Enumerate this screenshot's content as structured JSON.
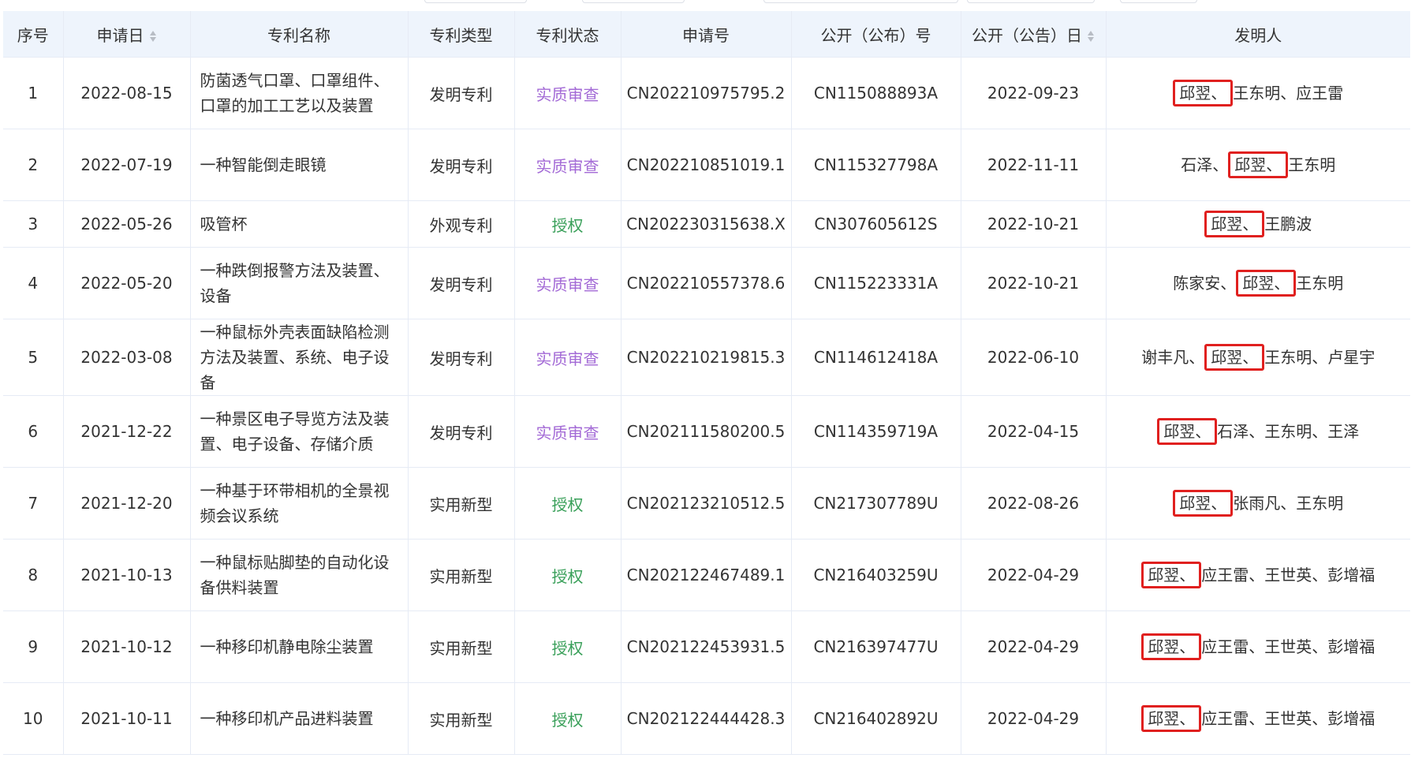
{
  "table": {
    "headers": [
      "序号",
      "申请日",
      "专利名称",
      "专利类型",
      "专利状态",
      "申请号",
      "公开（公布）号",
      "公开（公告）日",
      "发明人"
    ],
    "rows": [
      {
        "no": "1",
        "date": "2022-08-15",
        "name": "防菌透气口罩、口罩组件、口罩的加工工艺以及装置",
        "type": "发明专利",
        "status": "实质审查",
        "app_no": "CN202210975795.2",
        "pub_no": "CN115088893A",
        "pub_date": "2022-09-23",
        "inv_before": "",
        "inv_hl": "邱翌、",
        "inv_after": "王东明、应王雷"
      },
      {
        "no": "2",
        "date": "2022-07-19",
        "name": "一种智能倒走眼镜",
        "type": "发明专利",
        "status": "实质审查",
        "app_no": "CN202210851019.1",
        "pub_no": "CN115327798A",
        "pub_date": "2022-11-11",
        "inv_before": "石泽、",
        "inv_hl": "邱翌、",
        "inv_after": "王东明"
      },
      {
        "no": "3",
        "date": "2022-05-26",
        "name": "吸管杯",
        "type": "外观专利",
        "status": "授权",
        "app_no": "CN202230315638.X",
        "pub_no": "CN307605612S",
        "pub_date": "2022-10-21",
        "inv_before": "",
        "inv_hl": "邱翌、",
        "inv_after": "王鹏波"
      },
      {
        "no": "4",
        "date": "2022-05-20",
        "name": "一种跌倒报警方法及装置、设备",
        "type": "发明专利",
        "status": "实质审查",
        "app_no": "CN202210557378.6",
        "pub_no": "CN115223331A",
        "pub_date": "2022-10-21",
        "inv_before": "陈家安、",
        "inv_hl": "邱翌、",
        "inv_after": "王东明"
      },
      {
        "no": "5",
        "date": "2022-03-08",
        "name": "一种鼠标外壳表面缺陷检测方法及装置、系统、电子设备",
        "type": "发明专利",
        "status": "实质审查",
        "app_no": "CN202210219815.3",
        "pub_no": "CN114612418A",
        "pub_date": "2022-06-10",
        "inv_before": "谢丰凡、",
        "inv_hl": "邱翌、",
        "inv_after": "王东明、卢星宇"
      },
      {
        "no": "6",
        "date": "2021-12-22",
        "name": "一种景区电子导览方法及装置、电子设备、存储介质",
        "type": "发明专利",
        "status": "实质审查",
        "app_no": "CN202111580200.5",
        "pub_no": "CN114359719A",
        "pub_date": "2022-04-15",
        "inv_before": "",
        "inv_hl": "邱翌、",
        "inv_after": "石泽、王东明、王泽"
      },
      {
        "no": "7",
        "date": "2021-12-20",
        "name": "一种基于环带相机的全景视频会议系统",
        "type": "实用新型",
        "status": "授权",
        "app_no": "CN202123210512.5",
        "pub_no": "CN217307789U",
        "pub_date": "2022-08-26",
        "inv_before": "",
        "inv_hl": "邱翌、",
        "inv_after": "张雨凡、王东明"
      },
      {
        "no": "8",
        "date": "2021-10-13",
        "name": "一种鼠标贴脚垫的自动化设备供料装置",
        "type": "实用新型",
        "status": "授权",
        "app_no": "CN202122467489.1",
        "pub_no": "CN216403259U",
        "pub_date": "2022-04-29",
        "inv_before": "",
        "inv_hl": "邱翌、",
        "inv_after": "应王雷、王世英、彭增福"
      },
      {
        "no": "9",
        "date": "2021-10-12",
        "name": "一种移印机静电除尘装置",
        "type": "实用新型",
        "status": "授权",
        "app_no": "CN202122453931.5",
        "pub_no": "CN216397477U",
        "pub_date": "2022-04-29",
        "inv_before": "",
        "inv_hl": "邱翌、",
        "inv_after": "应王雷、王世英、彭增福"
      },
      {
        "no": "10",
        "date": "2021-10-11",
        "name": "一种移印机产品进料装置",
        "type": "实用新型",
        "status": "授权",
        "app_no": "CN202122444428.3",
        "pub_no": "CN216402892U",
        "pub_date": "2022-04-29",
        "inv_before": "",
        "inv_hl": "邱翌、",
        "inv_after": "应王雷、王世英、彭增福"
      }
    ]
  },
  "colors": {
    "header_bg": "#eef4fc",
    "status_exam": "#a36ad6",
    "status_grant": "#3aa05a",
    "highlight_box": "#e0201f"
  },
  "icons": {
    "sort": "sort-caret-icon"
  }
}
